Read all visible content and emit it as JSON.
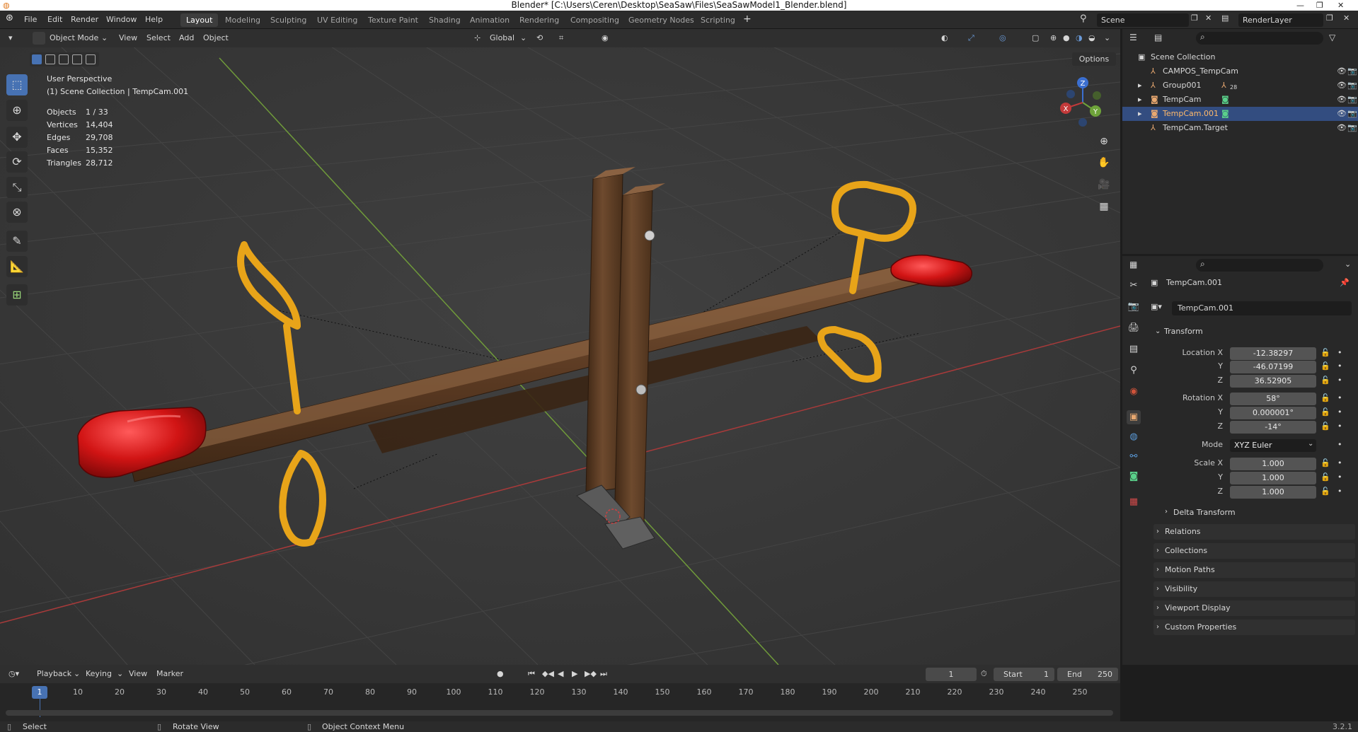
{
  "window": {
    "title": "Blender* [C:\\Users\\Ceren\\Desktop\\SeaSaw\\Files\\SeaSawModel1_Blender.blend]"
  },
  "menu": [
    "File",
    "Edit",
    "Render",
    "Window",
    "Help"
  ],
  "workspaces": [
    "Layout",
    "Modeling",
    "Sculpting",
    "UV Editing",
    "Texture Paint",
    "Shading",
    "Animation",
    "Rendering",
    "Compositing",
    "Geometry Nodes",
    "Scripting"
  ],
  "active_workspace": "Layout",
  "scene": {
    "name": "Scene",
    "view_layer": "RenderLayer"
  },
  "viewport_header": {
    "mode": "Object Mode",
    "items": [
      "View",
      "Select",
      "Add",
      "Object"
    ],
    "orientation": "Global",
    "options": "Options"
  },
  "viewport_info": {
    "perspective": "User Perspective",
    "collection": "(1) Scene Collection | TempCam.001",
    "stats": [
      {
        "label": "Objects",
        "value": "1 / 33"
      },
      {
        "label": "Vertices",
        "value": "14,404"
      },
      {
        "label": "Edges",
        "value": "29,708"
      },
      {
        "label": "Faces",
        "value": "15,352"
      },
      {
        "label": "Triangles",
        "value": "28,712"
      }
    ]
  },
  "gizmo": {
    "x": "X",
    "y": "Y",
    "z": "Z"
  },
  "outliner": {
    "root": "Scene Collection",
    "items": [
      {
        "name": "CAMPOS_TempCam",
        "extra": ""
      },
      {
        "name": "Group001",
        "extra": "28"
      },
      {
        "name": "TempCam",
        "extra": ""
      },
      {
        "name": "TempCam.001",
        "extra": ""
      },
      {
        "name": "TempCam.Target",
        "extra": ""
      }
    ]
  },
  "properties": {
    "object_name": "TempCam.001",
    "data_name": "TempCam.001",
    "transform_label": "Transform",
    "location": {
      "label": "Location X",
      "x": "-12.38297",
      "y": "-46.07199",
      "z": "36.52905"
    },
    "rotation": {
      "label": "Rotation X",
      "x": "58°",
      "y": "0.000001°",
      "z": "-14°"
    },
    "mode": {
      "label": "Mode",
      "value": "XYZ Euler"
    },
    "scale": {
      "label": "Scale X",
      "x": "1.000",
      "y": "1.000",
      "z": "1.000"
    },
    "axis_y": "Y",
    "axis_z": "Z",
    "delta_transform": "Delta Transform",
    "panels": [
      "Relations",
      "Collections",
      "Motion Paths",
      "Visibility",
      "Viewport Display",
      "Custom Properties"
    ]
  },
  "timeline": {
    "menus": [
      "Playback",
      "Keying",
      "View",
      "Marker"
    ],
    "current_frame": "1",
    "start_label": "Start",
    "start": "1",
    "end_label": "End",
    "end": "250",
    "ruler": [
      "1",
      "10",
      "20",
      "30",
      "40",
      "50",
      "60",
      "70",
      "80",
      "90",
      "100",
      "110",
      "120",
      "130",
      "140",
      "150",
      "160",
      "170",
      "180",
      "190",
      "200",
      "210",
      "220",
      "230",
      "240",
      "250"
    ]
  },
  "statusbar": {
    "select": "Select",
    "rotate": "Rotate View",
    "context": "Object Context Menu",
    "version": "3.2.1"
  },
  "colors": {
    "accent": "#4772b3",
    "selection": "#334d80",
    "seat_red": "#cc1414",
    "handle_yellow": "#e8a419",
    "wood": "#5a3a22",
    "x_axis": "#c33a3a",
    "y_axis": "#7aa33a"
  }
}
